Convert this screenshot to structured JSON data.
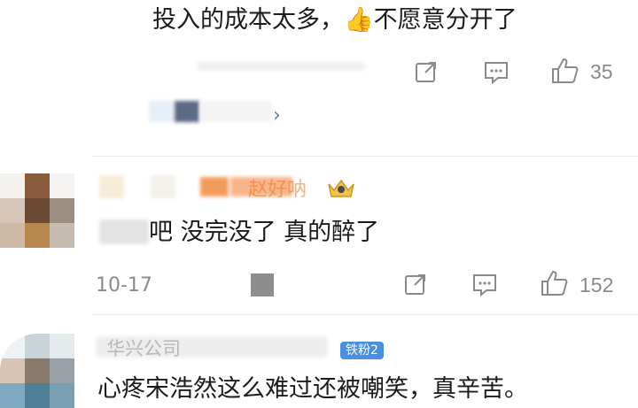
{
  "comments": [
    {
      "text": "投入的成本太多，👍不愿意分开了",
      "actions": {
        "like_count": "35"
      },
      "chevron": "›"
    },
    {
      "name_partial": "赵好呐",
      "text_partial": "吧  没完没了  真的醉了",
      "date_partial": "10-17",
      "actions": {
        "like_count": "152"
      }
    },
    {
      "name_partial": "华兴公司",
      "fan_badge": "铁粉2",
      "text": "心疼宋浩然这么难过还被嘲笑，真辛苦。"
    }
  ],
  "icons": {
    "share": "share-icon",
    "comment": "comment-icon",
    "like": "thumbs-up-icon",
    "chevron": "chevron-right-icon",
    "crown": "crown-icon"
  },
  "colors": {
    "text": "#1b1b1b",
    "meta": "#8a8a8a",
    "divider": "#e9e9e9",
    "badge": "#4a90e2"
  }
}
